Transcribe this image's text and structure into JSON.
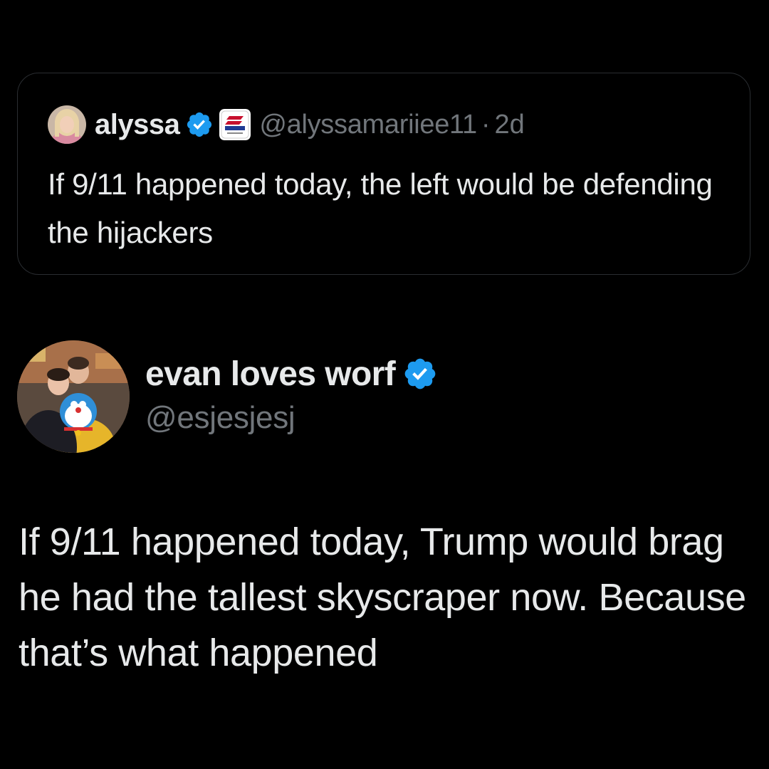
{
  "quoted_tweet": {
    "author_name": "alyssa",
    "verified": true,
    "affiliation_icon": "american-flag-badge-icon",
    "handle": "@alyssamariiee11",
    "separator": "·",
    "time": "2d",
    "text": "If 9/11 happened today, the left would be defending the hijackers"
  },
  "tweet": {
    "author_name": "evan loves worf",
    "verified": true,
    "handle": "@esjesjesj",
    "text": "If 9/11 happened today, Trump would brag he had the tallest skyscraper now. Because that’s what happened"
  },
  "colors": {
    "background": "#000000",
    "primary_text": "#e7e9ea",
    "secondary_text": "#71767b",
    "verified_blue": "#1d9bf0",
    "card_border": "#2a2d31"
  }
}
